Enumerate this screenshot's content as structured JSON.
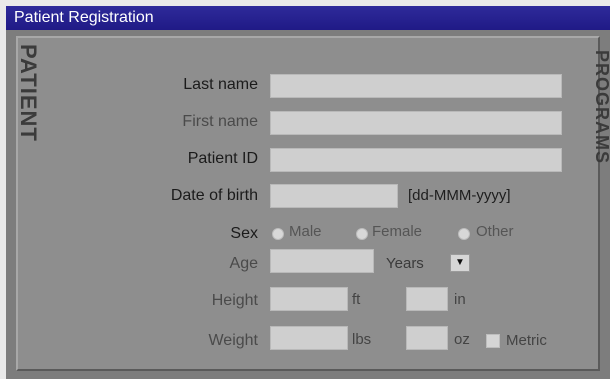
{
  "window": {
    "title": "Patient Registration",
    "side_label_left": "PATIENT",
    "side_label_right": "PROGRAMS"
  },
  "form": {
    "last_name": {
      "label": "Last name",
      "value": ""
    },
    "first_name": {
      "label": "First name",
      "value": ""
    },
    "patient_id": {
      "label": "Patient ID",
      "value": ""
    },
    "date_of_birth": {
      "label": "Date of birth",
      "value": "",
      "format_hint": "[dd-MMM-yyyy]"
    },
    "sex": {
      "label": "Sex",
      "options": [
        "Male",
        "Female",
        "Other"
      ]
    },
    "age": {
      "label": "Age",
      "value": "",
      "unit_selected": "Years"
    },
    "height": {
      "label": "Height",
      "unit_1": "ft",
      "unit_2": "in"
    },
    "weight": {
      "label": "Weight",
      "unit_1": "lbs",
      "unit_2": "oz"
    },
    "metric": {
      "label": "Metric",
      "checked": false
    }
  },
  "icons": {
    "dropdown": "dropdown-arrow-icon"
  }
}
